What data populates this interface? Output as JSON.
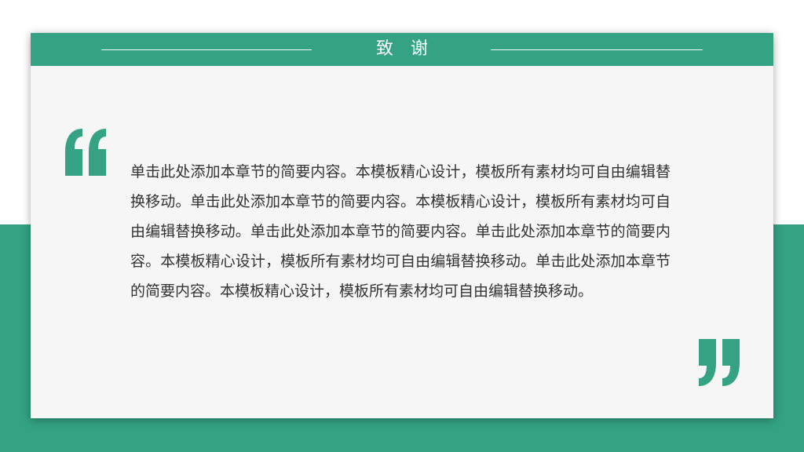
{
  "slide": {
    "title": "致谢",
    "body": "单击此处添加本章节的简要内容。本模板精心设计，模板所有素材均可自由编辑替换移动。单击此处添加本章节的简要内容。本模板精心设计，模板所有素材均可自由编辑替换移动。单击此处添加本章节的简要内容。单击此处添加本章节的简要内容。本模板精心设计，模板所有素材均可自由编辑替换移动。单击此处添加本章节的简要内容。本模板精心设计，模板所有素材均可自由编辑替换移动。"
  },
  "colors": {
    "accent": "#34a283",
    "card": "#f6f6f6",
    "text": "#333333"
  },
  "icons": {
    "open_quote": "open-quote-icon",
    "close_quote": "close-quote-icon"
  }
}
